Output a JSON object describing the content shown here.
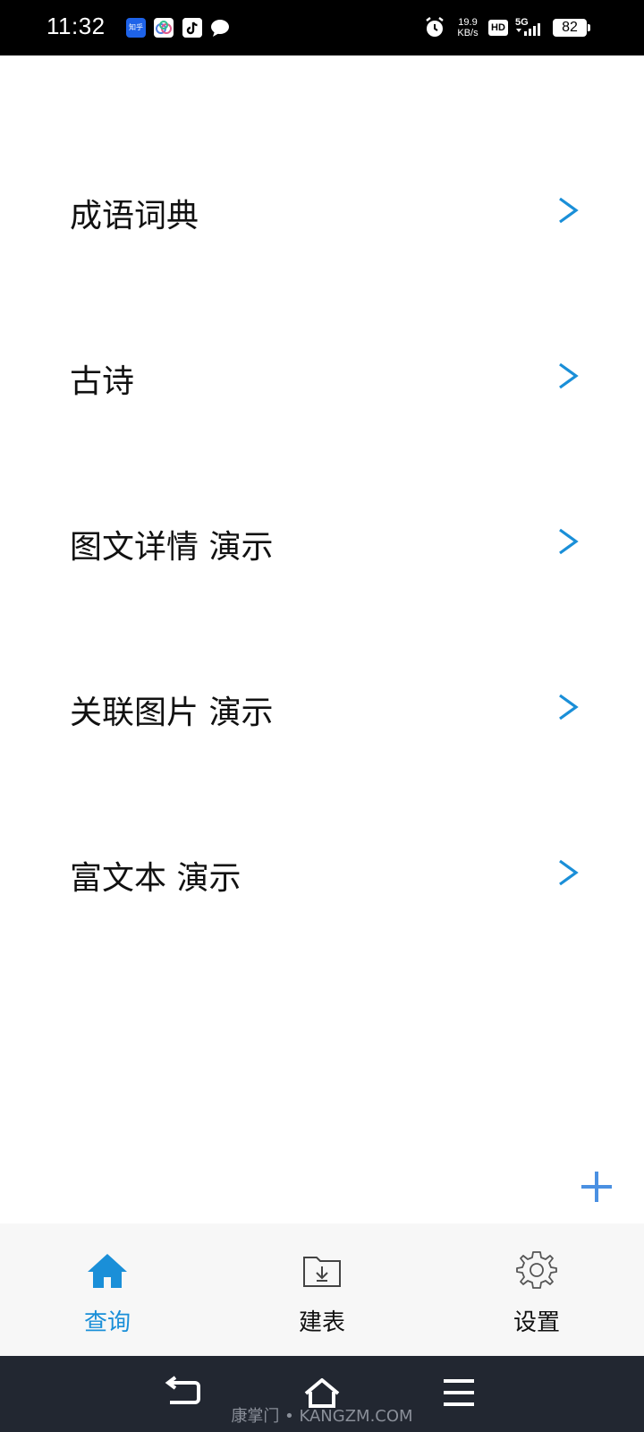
{
  "status_bar": {
    "time": "11:32",
    "notification_icons": [
      "zhihu-icon",
      "cloud-app-icon",
      "tiktok-icon",
      "chat-bubble-icon"
    ],
    "zhihu_text": "知乎",
    "network_speed_value": "19.9",
    "network_speed_unit": "KB/s",
    "hd_label": "HD",
    "network_type": "5G",
    "battery_level": "82"
  },
  "menu": {
    "items": [
      {
        "label": "成语词典"
      },
      {
        "label": "古诗"
      },
      {
        "label": "图文详情 演示"
      },
      {
        "label": "关联图片 演示"
      },
      {
        "label": "富文本 演示"
      }
    ]
  },
  "tabs": [
    {
      "label": "查询",
      "icon": "home-icon",
      "active": true
    },
    {
      "label": "建表",
      "icon": "folder-download-icon",
      "active": false
    },
    {
      "label": "设置",
      "icon": "gear-icon",
      "active": false
    }
  ],
  "colors": {
    "accent": "#1a8fd8",
    "chevron": "#1a8fd8",
    "fab": "#4a90e2",
    "navbar": "#222731",
    "tabbar": "#f7f7f7"
  },
  "nav": {
    "watermark": "康掌门 • KANGZM.COM"
  }
}
